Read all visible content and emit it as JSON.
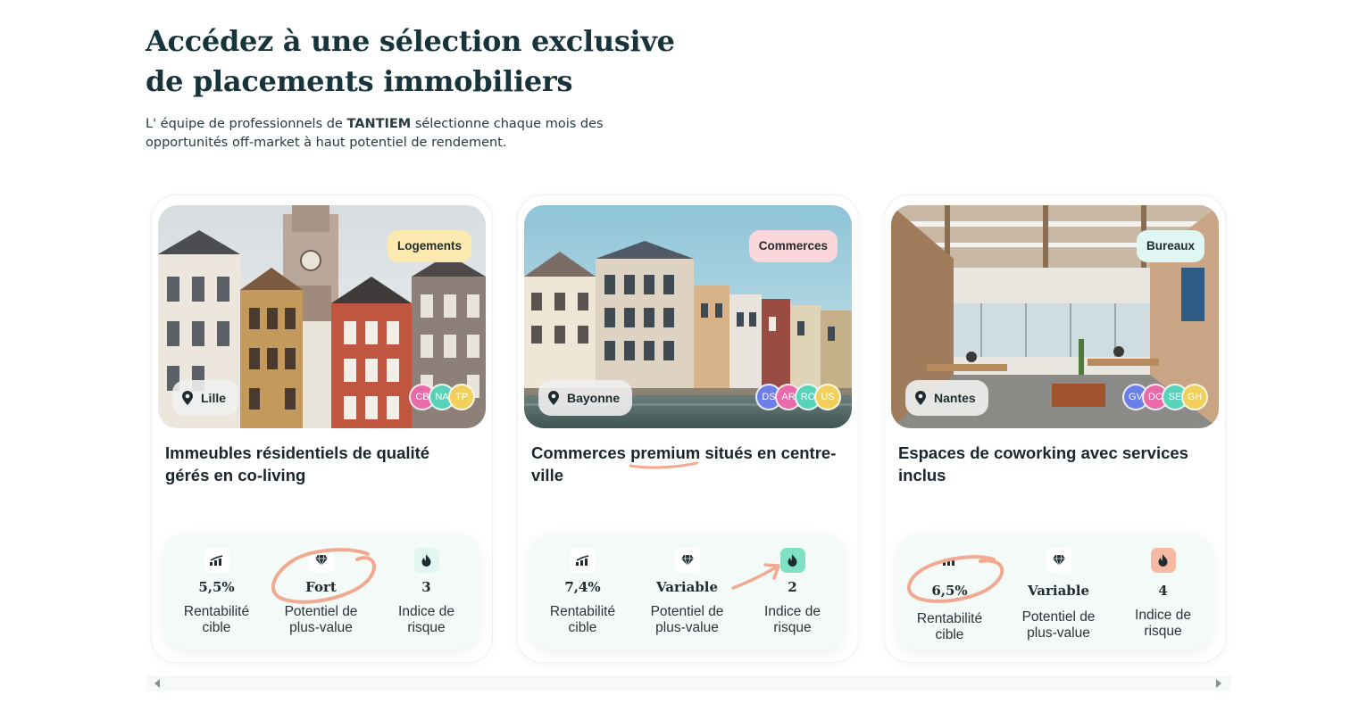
{
  "hero": {
    "title_line1": "Accédez à une sélection exclusive",
    "title_line2": "de placements immobiliers",
    "subtitle_before": "L' équipe de professionnels de ",
    "subtitle_brand": "TANTIEM",
    "subtitle_after": " sélectionne chaque mois des opportunités off-market à haut potentiel de rendement."
  },
  "cards": [
    {
      "tag": "Logements",
      "tag_color": "#fbe9b0",
      "location": "Lille",
      "avatars": [
        {
          "initials": "CB",
          "color": "#e86aa8"
        },
        {
          "initials": "NA",
          "color": "#59d3b8"
        },
        {
          "initials": "TP",
          "color": "#f0cf5a"
        }
      ],
      "title_before": "Immeubles résidentiels de qualité gérés en co-living",
      "stats": [
        {
          "value": "5,5%",
          "label_line1": "Rentabilité",
          "label_line2": "cible",
          "icon": "chart-trend-icon"
        },
        {
          "value": "Fort",
          "label_line1": "Potentiel de",
          "label_line2": "plus-value",
          "icon": "diamond-icon"
        },
        {
          "value": "3",
          "label_line1": "Indice de",
          "label_line2": "risque",
          "icon": "flame-icon"
        }
      ]
    },
    {
      "tag": "Commerces",
      "tag_color": "#fbd7dc",
      "location": "Bayonne",
      "avatars": [
        {
          "initials": "DS",
          "color": "#6b7fe8"
        },
        {
          "initials": "AR",
          "color": "#e86aa8"
        },
        {
          "initials": "RO",
          "color": "#59d3b8"
        },
        {
          "initials": "US",
          "color": "#f0cf5a"
        }
      ],
      "title_before": "Commerces ",
      "title_highlight": "premium",
      "title_after": " situés en centre-ville",
      "stats": [
        {
          "value": "7,4%",
          "label_line1": "Rentabilité",
          "label_line2": "cible",
          "icon": "chart-trend-icon"
        },
        {
          "value": "Variable",
          "label_line1": "Potentiel de",
          "label_line2": "plus-value",
          "icon": "diamond-icon"
        },
        {
          "value": "2",
          "label_line1": "Indice de",
          "label_line2": "risque",
          "icon": "flame-icon"
        }
      ]
    },
    {
      "tag": "Bureaux",
      "tag_color": "#dff6f3",
      "location": "Nantes",
      "avatars": [
        {
          "initials": "GV",
          "color": "#6b7fe8"
        },
        {
          "initials": "DC",
          "color": "#e86aa8"
        },
        {
          "initials": "SE",
          "color": "#59d3b8"
        },
        {
          "initials": "GH",
          "color": "#f0cf5a"
        }
      ],
      "title_before": "Espaces de coworking avec services inclus",
      "stats": [
        {
          "value": "6,5%",
          "label_line1": "Rentabilité",
          "label_line2": "cible",
          "icon": "chart-trend-icon"
        },
        {
          "value": "Variable",
          "label_line1": "Potentiel de",
          "label_line2": "plus-value",
          "icon": "diamond-icon"
        },
        {
          "value": "4",
          "label_line1": "Indice de",
          "label_line2": "risque",
          "icon": "flame-icon"
        }
      ]
    }
  ],
  "colors": {
    "annotation": "#f2a98f",
    "risk_low_bg": "#7fe0c4",
    "risk_high_bg": "#f7b9a3",
    "stats_bg": "#f3faf8"
  }
}
